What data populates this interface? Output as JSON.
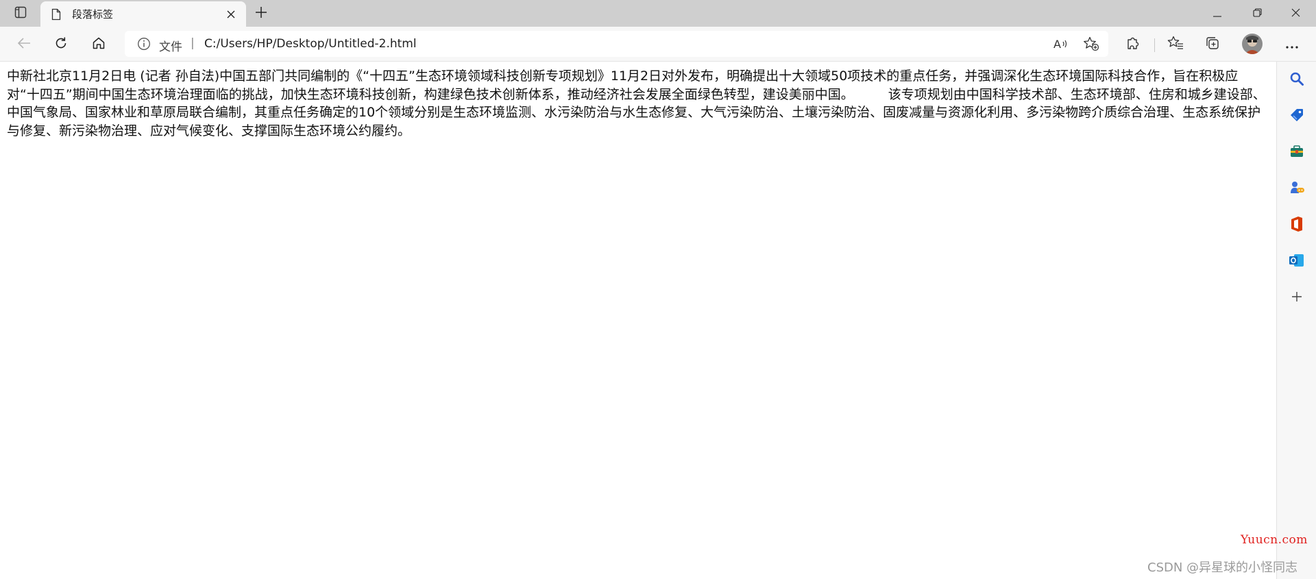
{
  "tab": {
    "title": "段落标签"
  },
  "address_bar": {
    "scheme_label": "文件",
    "separator": "|",
    "url": "C:/Users/HP/Desktop/Untitled-2.html"
  },
  "content": {
    "paragraph_1": "中新社北京11月2日电 (记者 孙自法)中国五部门共同编制的《“十四五”生态环境领域科技创新专项规划》11月2日对外发布，明确提出十大领域50项技术的重点任务，并强调深化生态环境国际科技合作，旨在积极应对“十四五”期间中国生态环境治理面临的挑战，加快生态环境科技创新，构建绿色技术创新体系，推动经济社会发展全面绿色转型，建设美丽中国。",
    "paragraph_2": "该专项规划由中国科学技术部、生态环境部、住房和城乡建设部、中国气象局、国家林业和草原局联合编制，其重点任务确定的10个领域分别是生态环境监测、水污染防治与水生态修复、大气污染防治、土壤污染防治、固废减量与资源化利用、多污染物跨介质综合治理、生态系统保护与修复、新污染物治理、应对气候变化、支撑国际生态环境公约履约。"
  },
  "sidebar": {
    "items": [
      {
        "icon": "search-icon"
      },
      {
        "icon": "shopping-tag-icon"
      },
      {
        "icon": "tools-icon"
      },
      {
        "icon": "games-icon"
      },
      {
        "icon": "office-icon"
      },
      {
        "icon": "outlook-icon"
      },
      {
        "icon": "add-icon"
      }
    ]
  },
  "watermarks": {
    "site": "Yuucn.com",
    "author": "CSDN @异星球的小怪同志"
  },
  "colors": {
    "tabstrip_bg": "#cfcfcf",
    "toolbar_bg": "#f7f7f7",
    "search_accent": "#2f5fd0",
    "office_red": "#d83b01",
    "outlook_blue": "#0f6cbd",
    "watermark_red": "#e0201e"
  }
}
